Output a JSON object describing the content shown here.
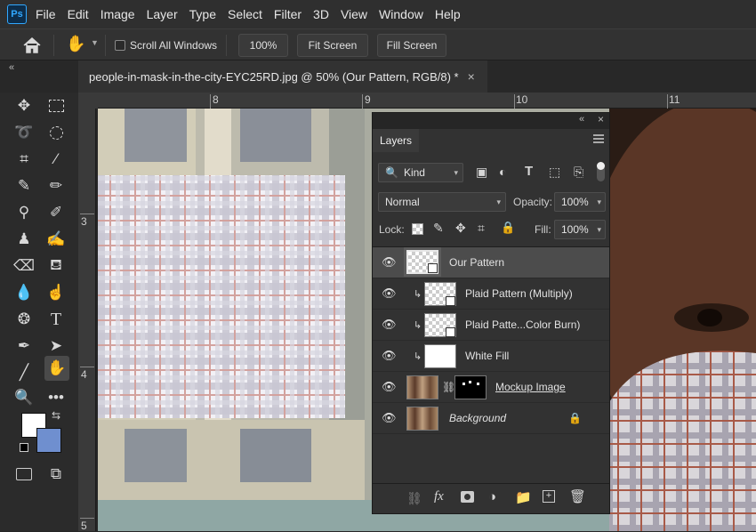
{
  "app": {
    "logo": "Ps"
  },
  "menu": [
    "File",
    "Edit",
    "Image",
    "Layer",
    "Type",
    "Select",
    "Filter",
    "3D",
    "View",
    "Window",
    "Help"
  ],
  "options": {
    "scroll_all_windows": "Scroll All Windows",
    "zoom_100": "100%",
    "fit_screen": "Fit Screen",
    "fill_screen": "Fill Screen"
  },
  "document_tab": {
    "title": "people-in-mask-in-the-city-EYC25RD.jpg @ 50% (Our Pattern, RGB/8) *",
    "close": "×"
  },
  "rulers": {
    "top": [
      "8",
      "9",
      "10",
      "11"
    ],
    "left": [
      "3",
      "4",
      "5"
    ]
  },
  "colors": {
    "foreground": "#ffffff",
    "background": "#6f8fcf",
    "ps_accent": "#31a8ff"
  },
  "layers_panel": {
    "title": "Layers",
    "filter_kind": "Kind",
    "blend_mode": "Normal",
    "opacity_label": "Opacity:",
    "opacity_value": "100%",
    "lock_label": "Lock:",
    "fill_label": "Fill:",
    "fill_value": "100%",
    "layers": [
      {
        "name": "Our Pattern",
        "selected": true
      },
      {
        "name": "Plaid Pattern (Multiply)",
        "clipped": true
      },
      {
        "name": "Plaid Patte...Color Burn)",
        "clipped": true
      },
      {
        "name": "White Fill",
        "clipped": true
      },
      {
        "name": "Mockup Image"
      },
      {
        "name": "Background",
        "locked": true
      }
    ],
    "footer_icons": [
      "link-icon",
      "fx-icon",
      "mask-icon",
      "adjustment-icon",
      "folder-icon",
      "new-layer-icon",
      "trash-icon"
    ]
  }
}
